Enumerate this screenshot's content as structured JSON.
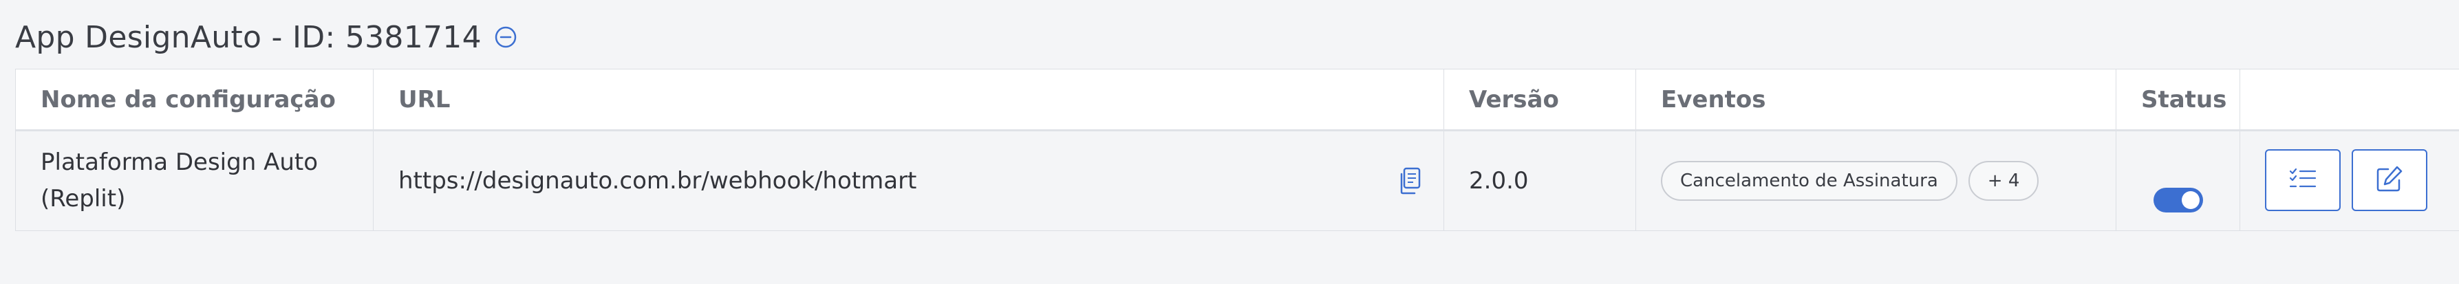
{
  "header": {
    "title": "App DesignAuto - ID: 5381714",
    "collapse_icon": "minus-circle-icon"
  },
  "table": {
    "columns": [
      "Nome da configuração",
      "URL",
      "Versão",
      "Eventos",
      "Status",
      ""
    ],
    "rows": [
      {
        "name": "Plataforma Design Auto (Replit)",
        "url": "https://designauto.com.br/webhook/hotmart",
        "version": "2.0.0",
        "events": [
          "Cancelamento de Assinatura"
        ],
        "events_more": "+ 4",
        "status_enabled": true,
        "actions": [
          "checklist-icon",
          "edit-icon"
        ]
      }
    ]
  },
  "colors": {
    "accent": "#3c6fd1",
    "header_text": "#6a6e76",
    "body_text": "#32343a",
    "background": "#f4f5f7"
  }
}
